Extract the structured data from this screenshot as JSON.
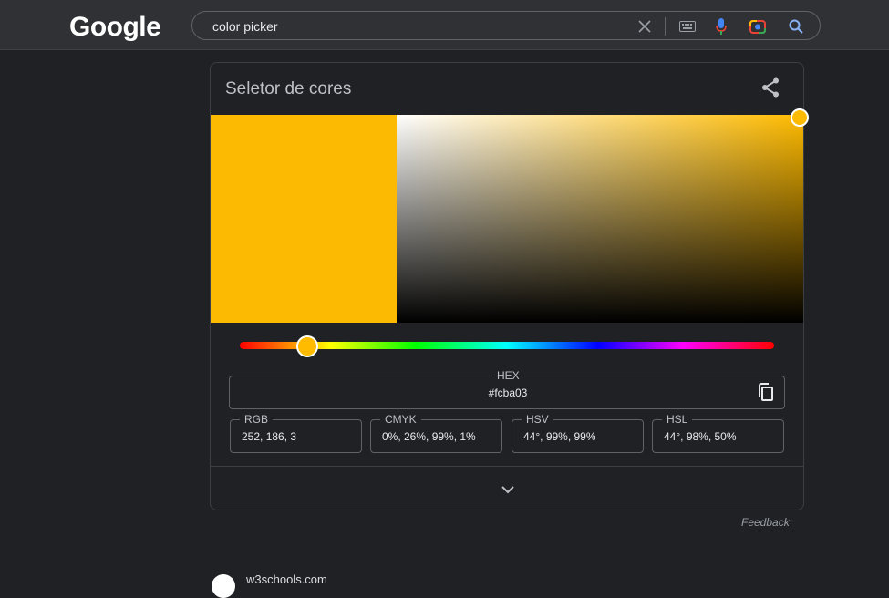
{
  "header": {
    "logo_text": "Google",
    "search_value": "color picker",
    "icons": [
      "close-icon",
      "keyboard-icon",
      "mic-icon",
      "lens-icon",
      "search-icon"
    ]
  },
  "card": {
    "title": "Seletor de cores",
    "share_icon": "share-icon",
    "selected_color": "#fcba03",
    "hue_color": "#ffbb00",
    "hue_degrees": 44,
    "hex": {
      "label": "HEX",
      "value": "#fcba03"
    },
    "fields": [
      {
        "label": "RGB",
        "value": "252, 186, 3"
      },
      {
        "label": "CMYK",
        "value": "0%, 26%, 99%, 1%"
      },
      {
        "label": "HSV",
        "value": "44°, 99%, 99%"
      },
      {
        "label": "HSL",
        "value": "44°, 98%, 50%"
      }
    ],
    "expand_icon": "chevron-down-icon"
  },
  "feedback_label": "Feedback",
  "next_result": {
    "site": "w3schools.com"
  }
}
